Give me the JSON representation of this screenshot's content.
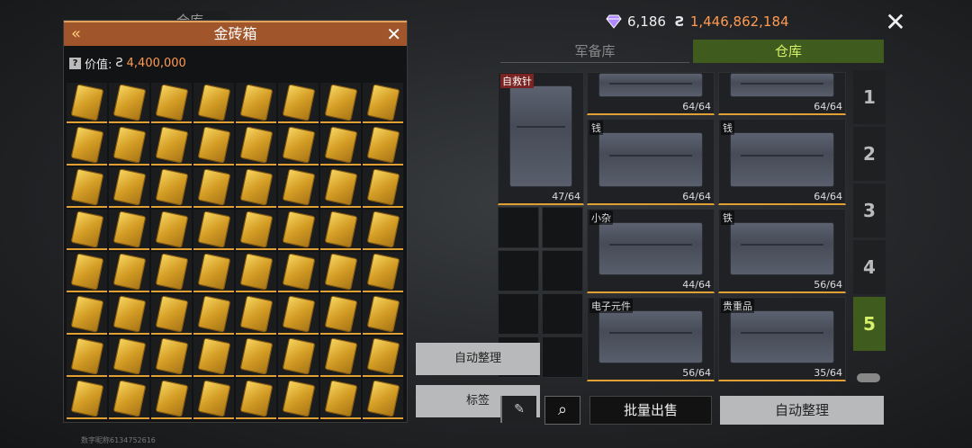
{
  "background": {
    "tab_text": "仓库"
  },
  "currency": {
    "gems": "6,186",
    "coins": "1,446,862,184",
    "coin_symbol": "Ƨ"
  },
  "gold_box": {
    "title": "金砖箱",
    "value_label": "价值:",
    "value_symbol": "Ƨ",
    "value": "4,400,000",
    "item_count": 64
  },
  "tabs": {
    "armory": "军备库",
    "warehouse": "仓库"
  },
  "storage": {
    "slots": [
      {
        "tag": "自救针",
        "count": "47/64",
        "tag_style": "red"
      },
      {
        "tag": "",
        "count": "64/64"
      },
      {
        "tag": "",
        "count": "64/64"
      },
      {
        "tag": "钱",
        "count": "64/64"
      },
      {
        "tag": "钱",
        "count": "64/64"
      },
      {
        "tag": "小杂",
        "count": "44/64"
      },
      {
        "tag": "铁",
        "count": "56/64"
      },
      {
        "tag": "电子元件",
        "count": "56/64"
      },
      {
        "tag": "贵重品",
        "count": "35/64"
      }
    ]
  },
  "pages": [
    "1",
    "2",
    "3",
    "4",
    "5"
  ],
  "active_page": "5",
  "buttons": {
    "auto_sort_left": "自动整理",
    "tag": "标签",
    "bulk_sell": "批量出售",
    "auto_sort_right": "自动整理"
  },
  "footer": "数字昵称6134752616",
  "colors": {
    "accent_green": "#3f5b1d",
    "highlight_orange": "#ff9a52",
    "panel_header": "#a0552a"
  }
}
